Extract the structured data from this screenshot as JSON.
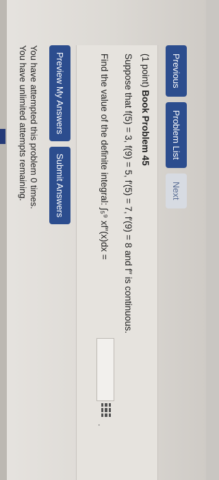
{
  "nav": {
    "previous_label": "Previous",
    "problem_list_label": "Problem List",
    "next_label": "Next"
  },
  "problem": {
    "points": "(1 point)",
    "title": "Book Problem 45",
    "given": "Suppose that f(5) = 3, f(9) = 5, f′(5) = 7, f′(9) = 8 and f″ is continuous.",
    "question": "Find the value of the definite integral: ∫₅⁹ xf″(x)dx =",
    "answer_value": "",
    "dot": "."
  },
  "actions": {
    "preview_label": "Preview My Answers",
    "submit_label": "Submit Answers"
  },
  "status": {
    "attempted": "You have attempted this problem 0 times.",
    "remaining": "You have unlimited attempts remaining."
  },
  "colors": {
    "button_blue": "#2c4d8e",
    "disabled_button": "#d7dbe2"
  }
}
